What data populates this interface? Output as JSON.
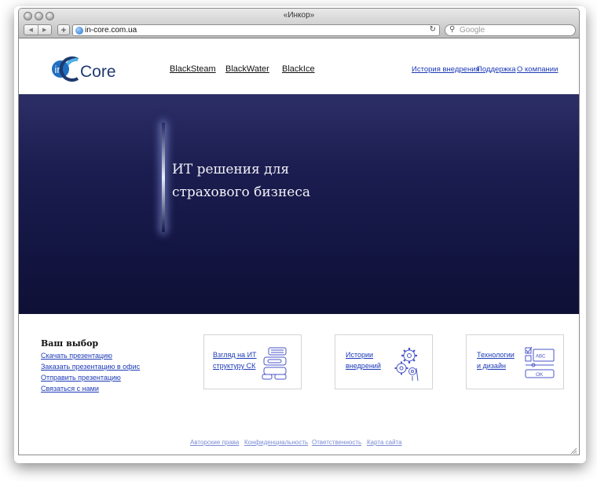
{
  "window": {
    "title": "«Инкор»",
    "nav_back": "◀",
    "nav_forward": "▶",
    "new_tab": "+",
    "url": "in-core.com.ua",
    "reload_icon": "↻",
    "search_placeholder": "Google",
    "search_icon": "⚲"
  },
  "logo": {
    "in": "in",
    "core": "Core",
    "colors": {
      "circle": "#1f6fc1",
      "text": "#1f3a6e",
      "ring": "#4fb3e8"
    }
  },
  "main_nav": [
    "BlackSteam",
    "BlackWater",
    "BlackIce"
  ],
  "secondary_nav": [
    "История внедрения",
    "Поддержка",
    "О компании"
  ],
  "hero": {
    "line1": "ИТ решения для",
    "line2": "страхового бизнеса"
  },
  "choice": {
    "title": "Ваш выбор",
    "links": [
      "Скачать презентацию",
      "Заказать презентацию в офис",
      "Отправить презентацию",
      "Связаться с нами"
    ]
  },
  "cards": [
    {
      "line1": "Взгляд на ИТ",
      "line2": "структуру СК",
      "icon": "stack-icon"
    },
    {
      "line1": "Истории",
      "line2": "внедрений",
      "icon": "gears-icon"
    },
    {
      "line1": "Технологии",
      "line2": "и дизайн",
      "icon": "ui-form-icon"
    }
  ],
  "card_icon_text": {
    "abc": "ABC",
    "ok": "OK"
  },
  "footer": [
    "Авторские права",
    "Конфиденциальность",
    "Ответственность",
    "Карта сайта"
  ],
  "colors": {
    "link": "#1c3ab7",
    "hero_bg": "#151746",
    "footer_link": "#7b8cd6",
    "icon_stroke": "#4a56c8"
  }
}
